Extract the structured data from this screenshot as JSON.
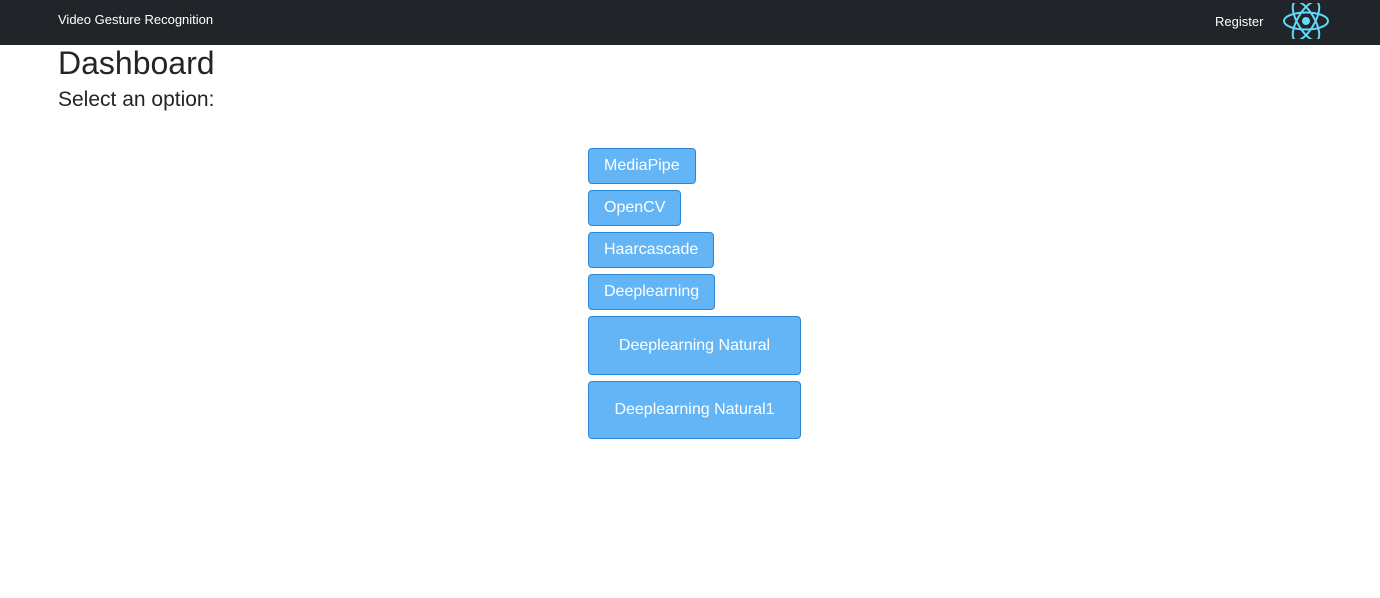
{
  "navbar": {
    "brand": "Video Gesture Recognition",
    "register_label": "Register",
    "logo_icon": "react-atom-icon",
    "logo_color": "#61dafb",
    "background": "#212529"
  },
  "main": {
    "title": "Dashboard",
    "subtitle": "Select an option:"
  },
  "options": [
    {
      "label": "MediaPipe"
    },
    {
      "label": "OpenCV"
    },
    {
      "label": "Haarcascade"
    },
    {
      "label": "Deeplearning"
    },
    {
      "label": "Deeplearning Natural"
    },
    {
      "label": "Deeplearning Natural1"
    }
  ],
  "colors": {
    "button_bg": "#64b5f6",
    "button_border": "#2b88d6",
    "button_text": "#ffffff"
  }
}
